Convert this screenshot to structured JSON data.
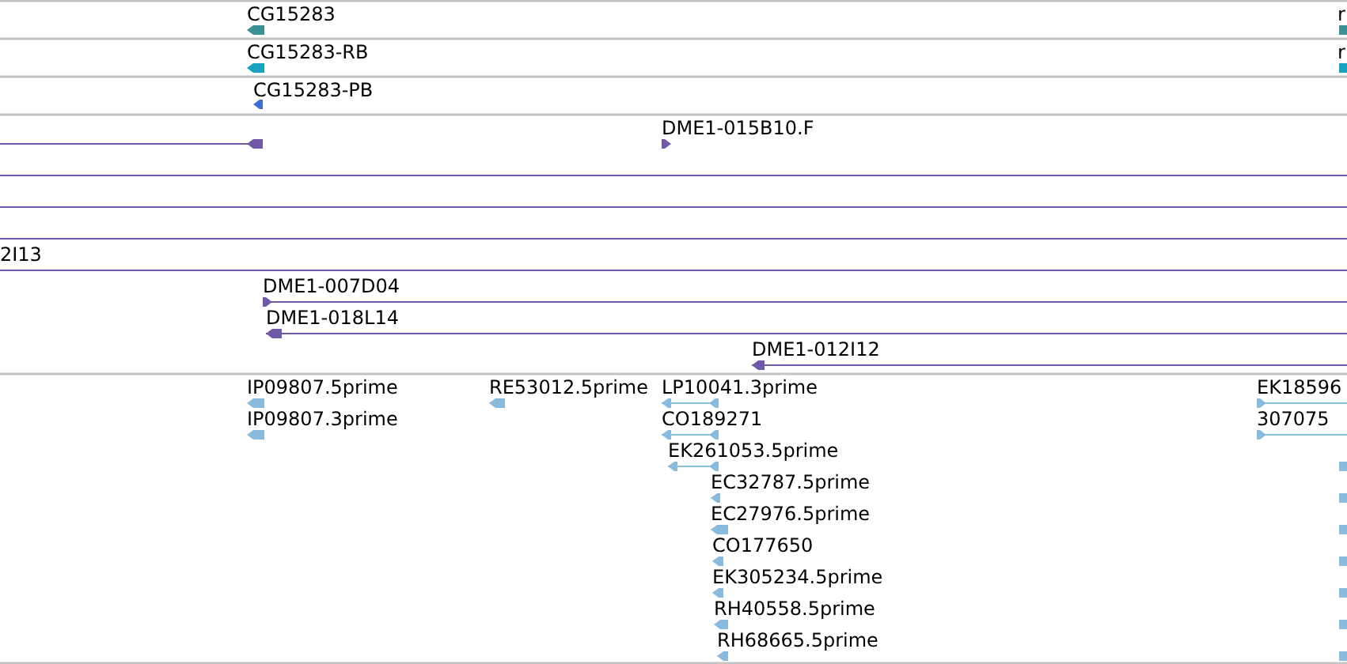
{
  "tracks": [
    {
      "color": "#3d9095",
      "features": [
        {
          "label": "CG15283",
          "kind": "reverse"
        },
        {
          "label": "r",
          "kind": "plain"
        }
      ]
    },
    {
      "color": "#17a2c0",
      "features": [
        {
          "label": "CG15283-RB",
          "kind": "reverse"
        },
        {
          "label": "r",
          "kind": "plain"
        }
      ]
    },
    {
      "color": "#3b6fd0",
      "features": [
        {
          "label": "CG15283-PB",
          "kind": "reverse"
        }
      ]
    },
    {
      "color": "#7059a8",
      "features": [
        {
          "kind": "reverse"
        },
        {
          "label": "DME1-015B10.F",
          "kind": "forward"
        },
        {
          "kind": "plain"
        },
        {
          "kind": "plain"
        },
        {
          "kind": "plain"
        },
        {
          "label": "2I13",
          "kind": "plain"
        },
        {
          "label": "DME1-007D04",
          "kind": "forward"
        },
        {
          "label": "DME1-018L14",
          "kind": "reverse"
        },
        {
          "label": "DME1-012I12",
          "kind": "reverse"
        }
      ]
    },
    {
      "color": "#88bbdd",
      "features": [
        {
          "label": "IP09807.5prime",
          "kind": "reverse"
        },
        {
          "label": "IP09807.3prime",
          "kind": "reverse"
        },
        {
          "label": "RE53012.5prime",
          "kind": "reverse"
        },
        {
          "label": "LP10041.3prime",
          "kind": "reverse"
        },
        {
          "label": "CO189271",
          "kind": "reverse"
        },
        {
          "label": "EK261053.5prime",
          "kind": "reverse"
        },
        {
          "label": "EC32787.5prime",
          "kind": "reverse"
        },
        {
          "label": "EC27976.5prime",
          "kind": "reverse"
        },
        {
          "label": "CO177650",
          "kind": "reverse"
        },
        {
          "label": "EK305234.5prime",
          "kind": "reverse"
        },
        {
          "label": "RH40558.5prime",
          "kind": "reverse"
        },
        {
          "label": "RH68665.5prime",
          "kind": "reverse"
        },
        {
          "label": "EK18596",
          "kind": "forward"
        },
        {
          "label": "307075",
          "kind": "forward"
        },
        {
          "kind": "plain"
        },
        {
          "kind": "plain"
        },
        {
          "kind": "plain"
        },
        {
          "kind": "plain"
        },
        {
          "kind": "plain"
        },
        {
          "kind": "plain"
        },
        {
          "kind": "plain"
        }
      ]
    }
  ]
}
